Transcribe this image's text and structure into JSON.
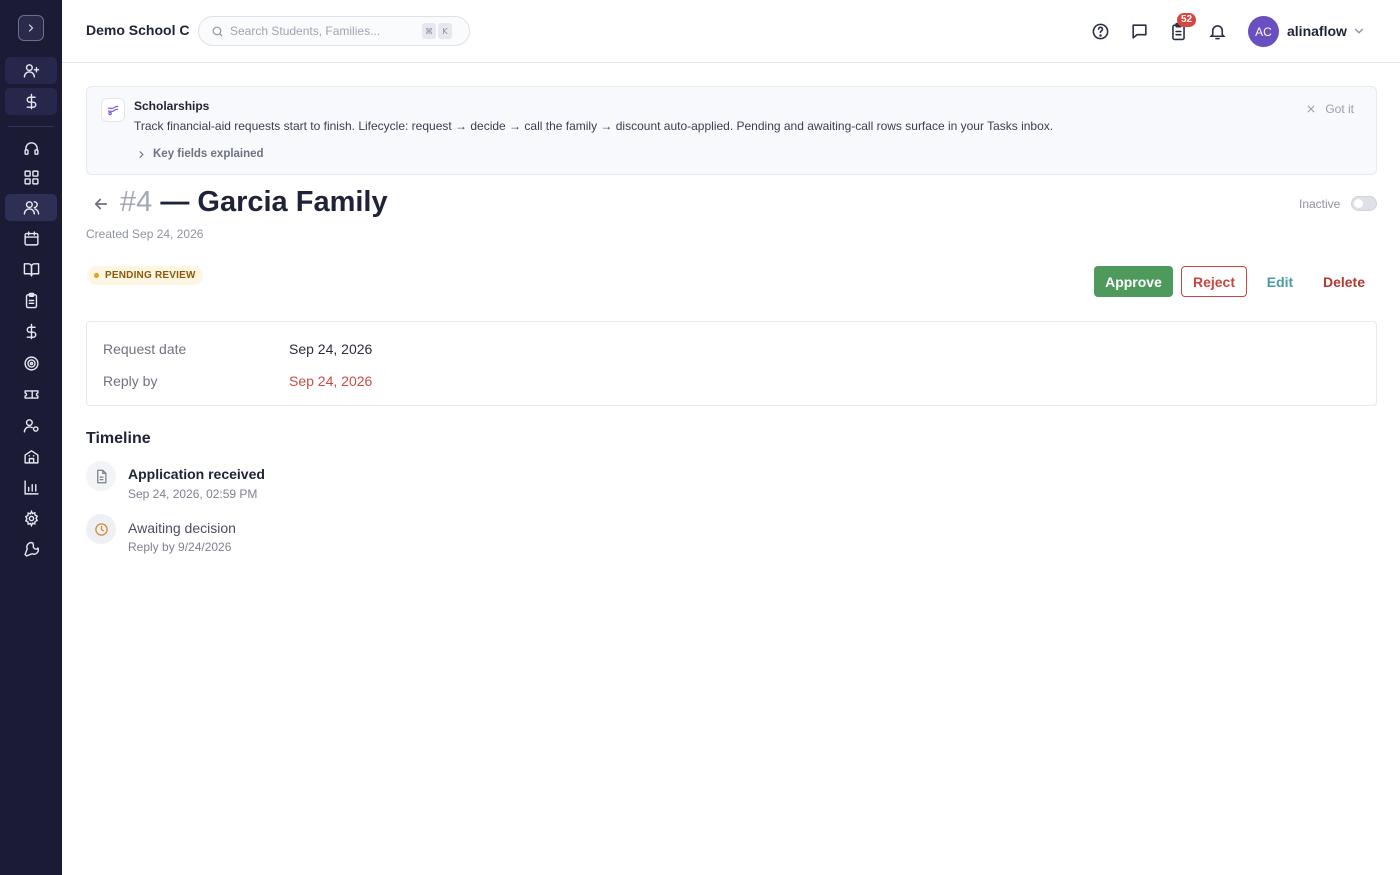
{
  "header": {
    "school_name": "Demo School C",
    "search_placeholder": "Search Students, Families...",
    "search_shortcut_keys": [
      "⌘",
      "K"
    ],
    "tasks_badge": "52",
    "avatar_initials": "AC",
    "username": "alinaflow"
  },
  "banner": {
    "title": "Scholarships",
    "text": "Track financial-aid requests start to finish. Lifecycle: request → decide → call the family → discount auto-applied. Pending and awaiting-call rows surface in your Tasks inbox.",
    "link": "Key fields explained",
    "dismiss": "Got it"
  },
  "record": {
    "number": "#4",
    "title": "— Garcia Family",
    "created": "Created Sep 24, 2026",
    "inactive_label": "Inactive",
    "status": "PENDING REVIEW"
  },
  "actions": {
    "approve": "Approve",
    "reject": "Reject",
    "edit": "Edit",
    "delete": "Delete"
  },
  "details": [
    {
      "label": "Request date",
      "value": "Sep 24, 2026"
    },
    {
      "label": "Reply by",
      "value": "Sep 24, 2026"
    }
  ],
  "timeline": {
    "heading": "Timeline",
    "events": [
      {
        "title": "Application received",
        "sub": "Sep 24, 2026, 02:59 PM",
        "icon": "document-icon"
      },
      {
        "title": "Awaiting decision",
        "sub": "Reply by 9/24/2026",
        "icon": "clock-icon"
      }
    ]
  },
  "colors": {
    "sidebar_bg": "#1b1b35",
    "approve": "#4e9a5d",
    "reject": "#c9463e",
    "overdue": "#cc4a42",
    "avatar": "#6a4fc0"
  }
}
